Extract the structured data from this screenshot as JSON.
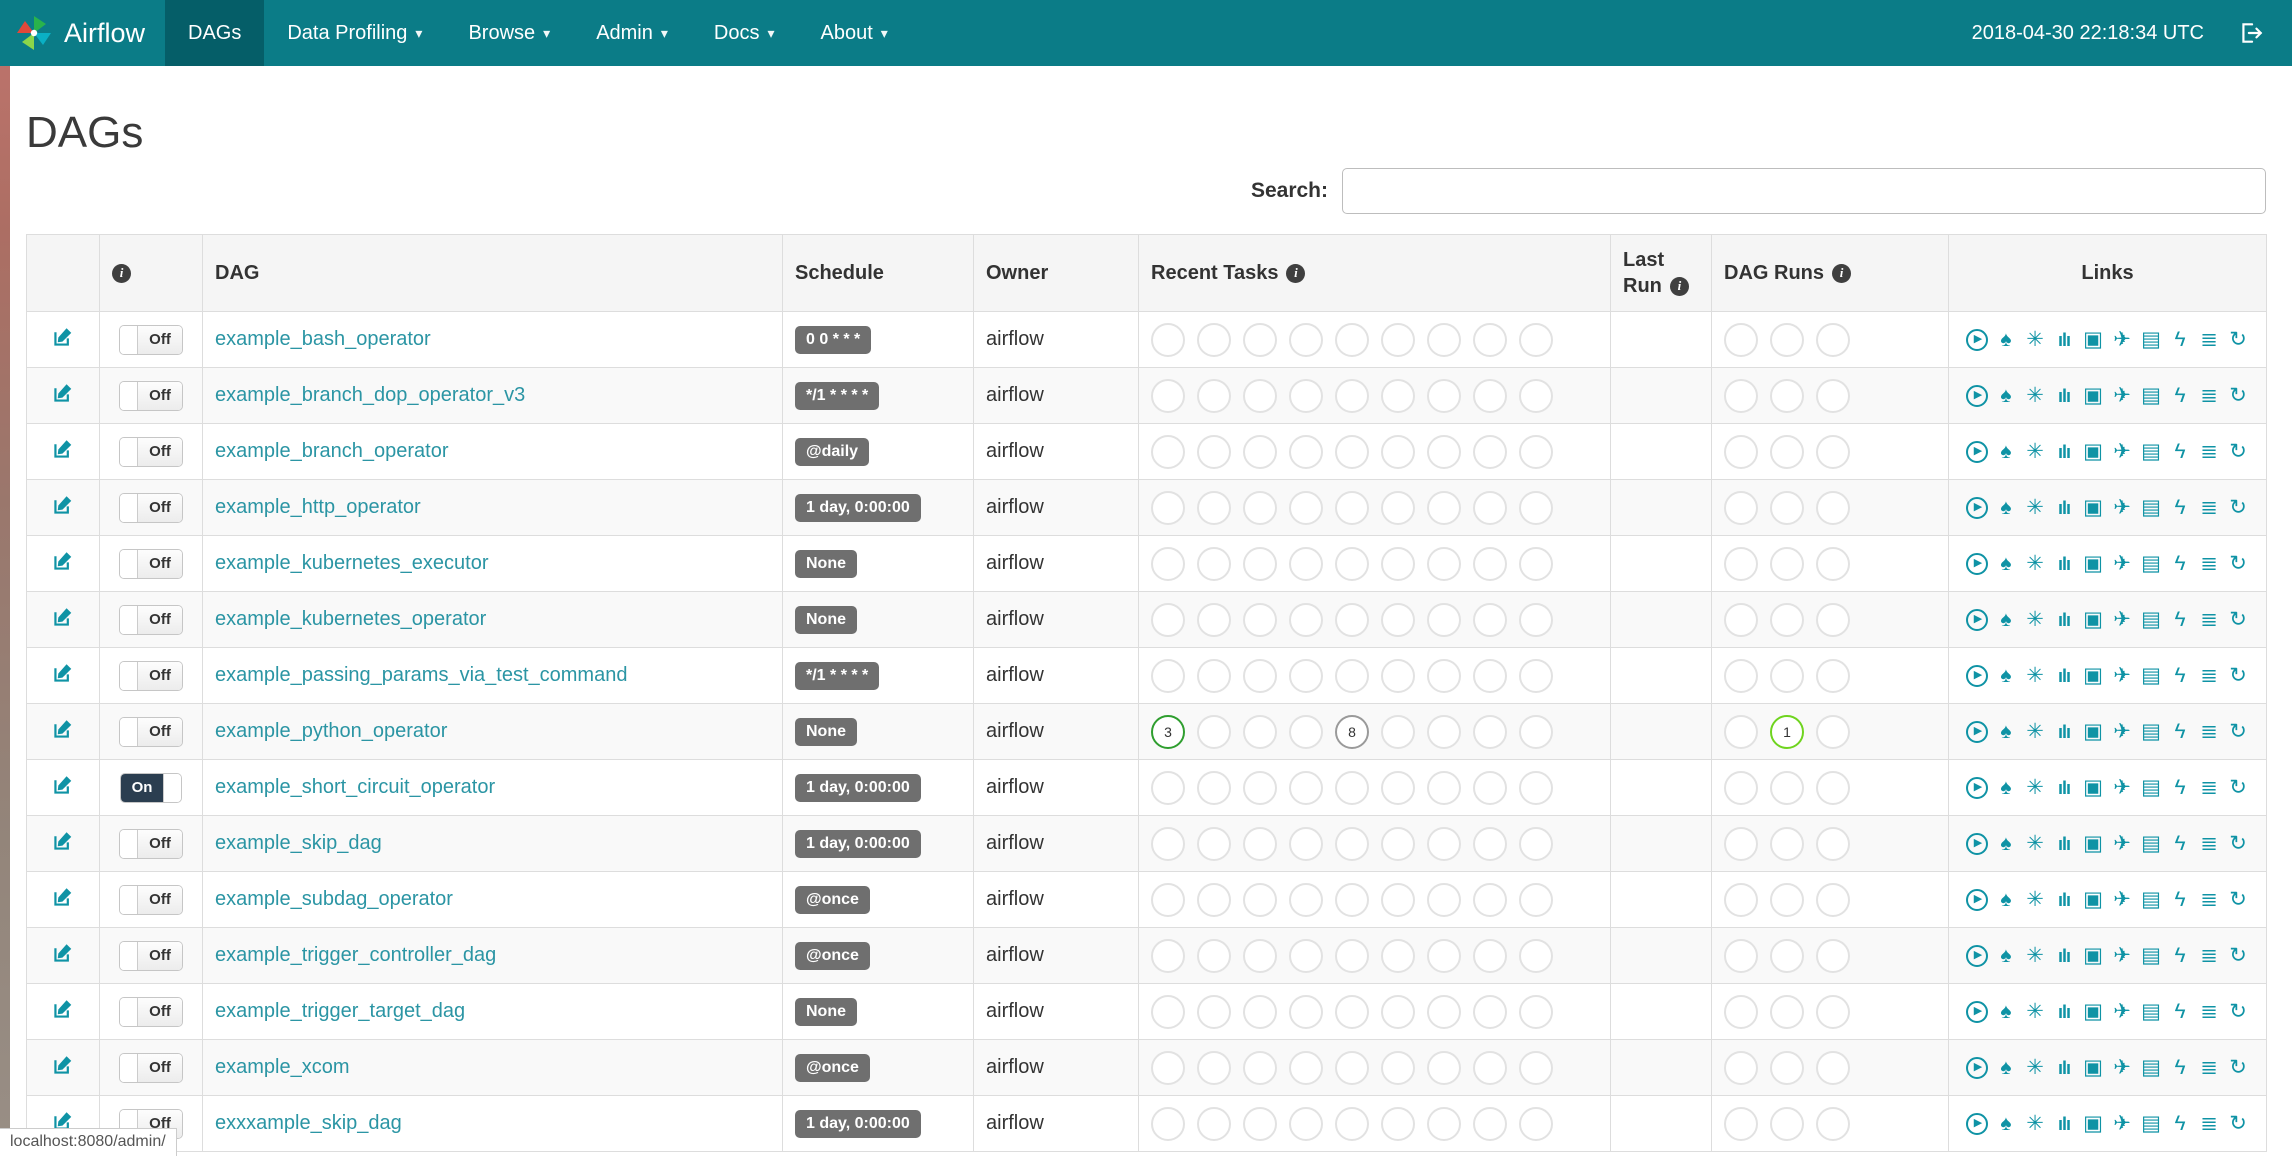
{
  "colors": {
    "navbar_bg": "#0b7c87",
    "navbar_active_bg": "#055e68",
    "accent_link": "#2b95a4",
    "accent_icon": "#0f93a5",
    "schedule_badge_bg": "#6f6f6f",
    "toggle_on_bg": "#2b3e50",
    "circle_border_default": "#e2e2e2",
    "task_success_green": "#2f9e2f",
    "task_none_gray": "#9a9a9a",
    "dagrun_running_green": "#6fd41f"
  },
  "icons": {
    "caret_glyph": "▾",
    "info_glyph": "i",
    "toggle_on_label": "On",
    "toggle_off_label": "Off"
  },
  "navbar": {
    "brand": "Airflow",
    "items": [
      {
        "label": "DAGs",
        "active": true,
        "dropdown": false
      },
      {
        "label": "Data Profiling",
        "active": false,
        "dropdown": true
      },
      {
        "label": "Browse",
        "active": false,
        "dropdown": true
      },
      {
        "label": "Admin",
        "active": false,
        "dropdown": true
      },
      {
        "label": "Docs",
        "active": false,
        "dropdown": true
      },
      {
        "label": "About",
        "active": false,
        "dropdown": true
      }
    ],
    "clock": "2018-04-30 22:18:34 UTC"
  },
  "page": {
    "title": "DAGs"
  },
  "search": {
    "label": "Search:",
    "value": "",
    "placeholder": ""
  },
  "statusbar": {
    "text": "localhost:8080/admin/"
  },
  "table": {
    "recent_task_circles": 9,
    "dag_run_circles": 3,
    "headers": [
      {
        "label": "",
        "info": false
      },
      {
        "label": "",
        "info": true
      },
      {
        "label": "DAG",
        "info": false
      },
      {
        "label": "Schedule",
        "info": false
      },
      {
        "label": "Owner",
        "info": false
      },
      {
        "label": "Recent Tasks",
        "info": true
      },
      {
        "label": "Last Run",
        "info": true
      },
      {
        "label": "DAG Runs",
        "info": true
      },
      {
        "label": "Links",
        "info": false,
        "align": "center"
      }
    ],
    "links_icons": [
      {
        "name": "trigger-dag-icon",
        "glyph": "▶",
        "style": "circled"
      },
      {
        "name": "tree-view-icon",
        "glyph": "♠"
      },
      {
        "name": "graph-view-icon",
        "glyph": "✳"
      },
      {
        "name": "task-duration-icon",
        "glyph": "ılı",
        "style": "duration"
      },
      {
        "name": "task-tries-icon",
        "glyph": "▣"
      },
      {
        "name": "landing-times-icon",
        "glyph": "✈"
      },
      {
        "name": "gantt-icon",
        "glyph": "▤"
      },
      {
        "name": "code-view-icon",
        "glyph": "ϟ"
      },
      {
        "name": "task-details-icon",
        "glyph": "≣"
      },
      {
        "name": "refresh-icon",
        "glyph": "↻"
      }
    ],
    "rows": [
      {
        "name": "example_bash_operator",
        "schedule": "0 0 * * *",
        "owner": "airflow",
        "enabled": false
      },
      {
        "name": "example_branch_dop_operator_v3",
        "schedule": "*/1 * * * *",
        "owner": "airflow",
        "enabled": false
      },
      {
        "name": "example_branch_operator",
        "schedule": "@daily",
        "owner": "airflow",
        "enabled": false
      },
      {
        "name": "example_http_operator",
        "schedule": "1 day, 0:00:00",
        "owner": "airflow",
        "enabled": false
      },
      {
        "name": "example_kubernetes_executor",
        "schedule": "None",
        "owner": "airflow",
        "enabled": false
      },
      {
        "name": "example_kubernetes_operator",
        "schedule": "None",
        "owner": "airflow",
        "enabled": false
      },
      {
        "name": "example_passing_params_via_test_command",
        "schedule": "*/1 * * * *",
        "owner": "airflow",
        "enabled": false
      },
      {
        "name": "example_python_operator",
        "schedule": "None",
        "owner": "airflow",
        "enabled": false,
        "recent_tasks": [
          {
            "count": 3,
            "color": "#2f9e2f"
          },
          null,
          null,
          null,
          {
            "count": 8,
            "color": "#9a9a9a"
          },
          null,
          null,
          null,
          null
        ],
        "dag_runs": [
          null,
          {
            "count": 1,
            "color": "#6fd41f"
          },
          null
        ]
      },
      {
        "name": "example_short_circuit_operator",
        "schedule": "1 day, 0:00:00",
        "owner": "airflow",
        "enabled": true
      },
      {
        "name": "example_skip_dag",
        "schedule": "1 day, 0:00:00",
        "owner": "airflow",
        "enabled": false
      },
      {
        "name": "example_subdag_operator",
        "schedule": "@once",
        "owner": "airflow",
        "enabled": false
      },
      {
        "name": "example_trigger_controller_dag",
        "schedule": "@once",
        "owner": "airflow",
        "enabled": false
      },
      {
        "name": "example_trigger_target_dag",
        "schedule": "None",
        "owner": "airflow",
        "enabled": false
      },
      {
        "name": "example_xcom",
        "schedule": "@once",
        "owner": "airflow",
        "enabled": false
      },
      {
        "name": "exxxample_skip_dag",
        "schedule": "1 day, 0:00:00",
        "owner": "airflow",
        "enabled": false
      }
    ]
  }
}
